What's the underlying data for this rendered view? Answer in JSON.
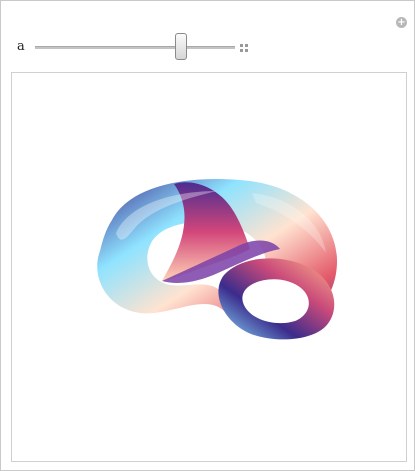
{
  "controls": {
    "slider": {
      "label": "a",
      "value_fraction": 0.73
    }
  },
  "icons": {
    "add": "plus-circle-icon",
    "expand": "expand-icon"
  },
  "plot": {
    "kind": "3d-surface",
    "shape": "twisted-torus-knot",
    "gradient_colors": [
      "#3a2d8f",
      "#8fe3ff",
      "#ffd9c2",
      "#e45a6a",
      "#7a3fa8"
    ]
  }
}
